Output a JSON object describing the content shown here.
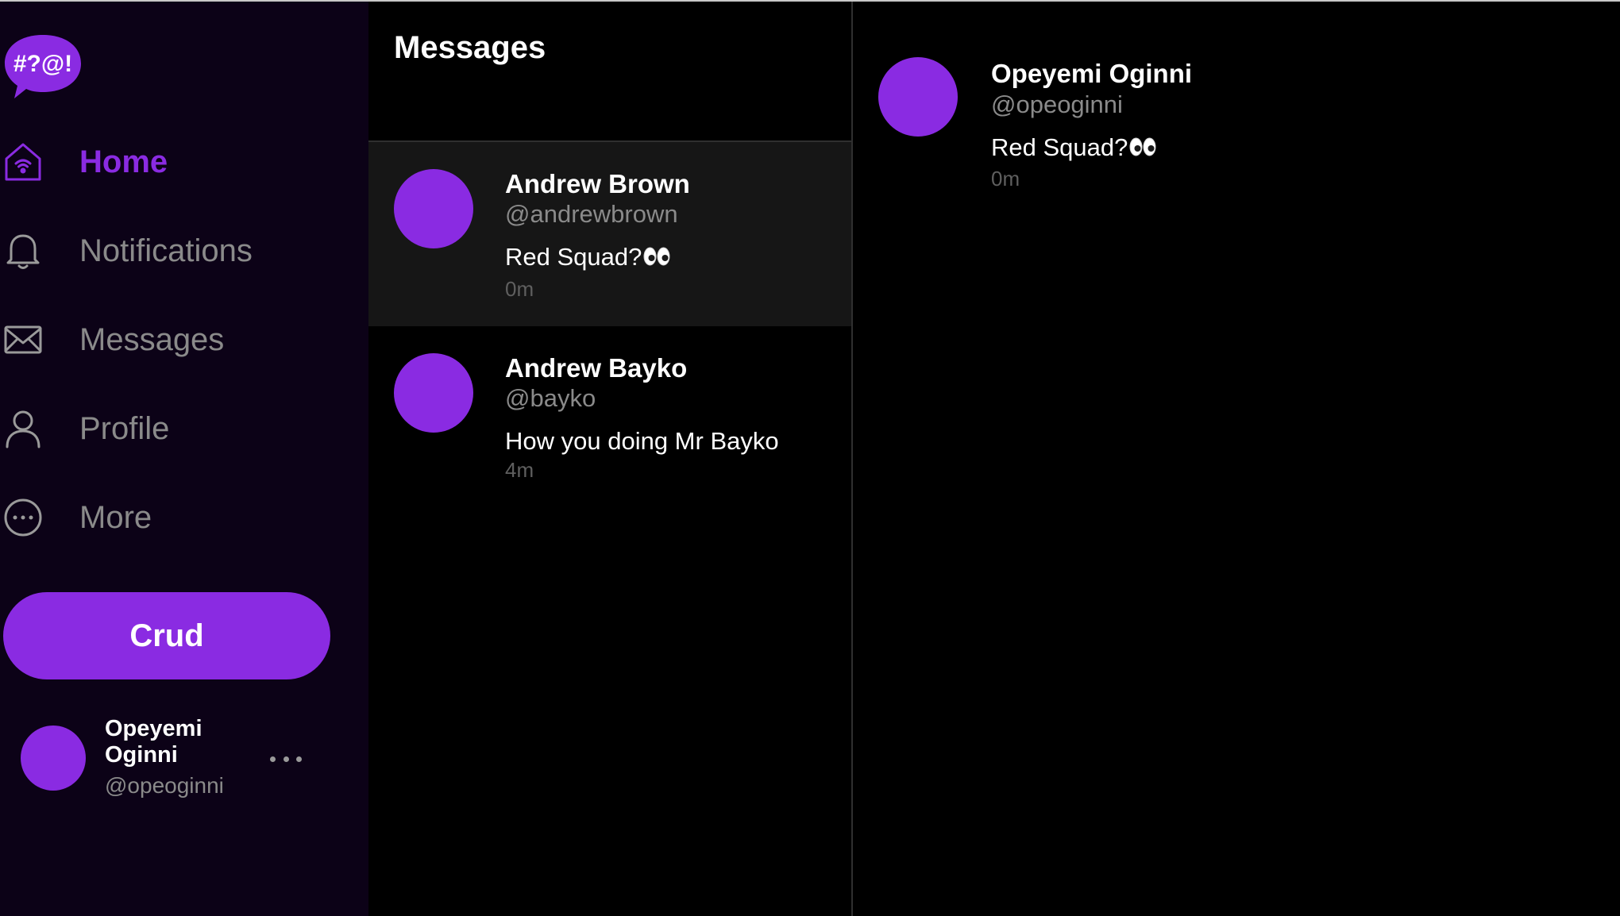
{
  "brand": {
    "logo_text": "#?@!",
    "accent_color": "#8a2be2"
  },
  "sidebar": {
    "items": [
      {
        "label": "Home",
        "icon": "home-icon",
        "active": true
      },
      {
        "label": "Notifications",
        "icon": "bell-icon",
        "active": false
      },
      {
        "label": "Messages",
        "icon": "mail-icon",
        "active": false
      },
      {
        "label": "Profile",
        "icon": "user-icon",
        "active": false
      },
      {
        "label": "More",
        "icon": "more-circle-icon",
        "active": false
      }
    ],
    "post_button_label": "Crud",
    "account": {
      "name": "Opeyemi Oginni",
      "handle": "@opeoginni"
    }
  },
  "messages": {
    "title": "Messages",
    "conversations": [
      {
        "name": "Andrew Brown",
        "handle": "@andrewbrown",
        "text": "Red Squad?",
        "emoji": "eyes-emoji",
        "time": "0m",
        "selected": true
      },
      {
        "name": "Andrew Bayko",
        "handle": "@bayko",
        "text": "How you doing Mr Bayko",
        "time": "4m",
        "selected": false
      }
    ]
  },
  "conversation": {
    "name": "Opeyemi Oginni",
    "handle": "@opeoginni",
    "text": "Red Squad?",
    "emoji": "eyes-emoji",
    "time": "0m"
  }
}
